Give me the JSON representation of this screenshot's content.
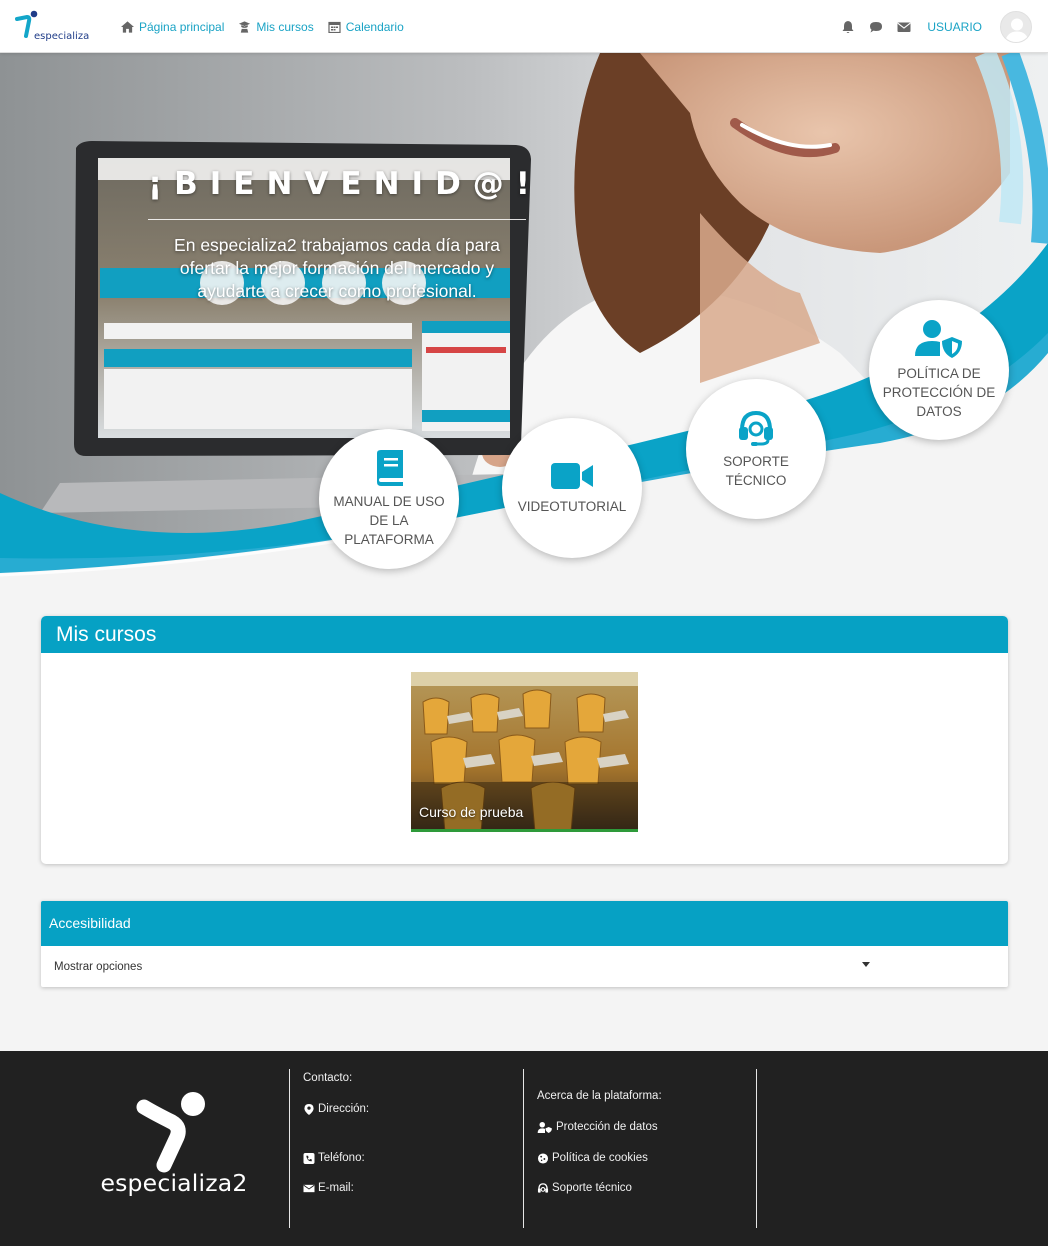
{
  "navbar": {
    "brand": "especializa2",
    "links": [
      {
        "label": "Página principal",
        "icon": "home-icon"
      },
      {
        "label": "Mis cursos",
        "icon": "graduate-icon"
      },
      {
        "label": "Calendario",
        "icon": "calendar-icon"
      }
    ],
    "user_label": "USUARIO",
    "icons": [
      "bell-icon",
      "chat-icon",
      "envelope-icon",
      "avatar"
    ]
  },
  "hero": {
    "title": "¡BIENVENID@!",
    "text": "En especializa2 trabajamos cada día para ofertar la mejor formación del mercado y ayudarte a crecer como profesional.",
    "buttons": [
      {
        "label": "MANUAL DE USO DE LA PLATAFORMA",
        "icon": "book-icon"
      },
      {
        "label": "VIDEOTUTORIAL",
        "icon": "video-camera-icon"
      },
      {
        "label": "SOPORTE TÉCNICO",
        "icon": "headset-icon"
      },
      {
        "label": "POLÍTICA DE PROTECCIÓN DE DATOS",
        "icon": "user-shield-icon"
      }
    ]
  },
  "courses": {
    "title": "Mis cursos",
    "items": [
      {
        "name": "Curso de prueba"
      }
    ]
  },
  "accessibility": {
    "title": "Accesibilidad",
    "toggle_label": "Mostrar opciones"
  },
  "footer": {
    "logo_text": "especializa2",
    "contact": {
      "heading": "Contacto:",
      "address_label": "Dirección:",
      "phone_label": "Teléfono:",
      "email_label": "E-mail:"
    },
    "about": {
      "heading": "Acerca de la plataforma:",
      "links": [
        "Protección de datos",
        "Política de cookies",
        "Soporte técnico"
      ]
    }
  },
  "colors": {
    "accent": "#06a1c4",
    "link": "#1aa3c5",
    "footer_bg": "#212121",
    "course_bar": "#2e9a3a"
  }
}
